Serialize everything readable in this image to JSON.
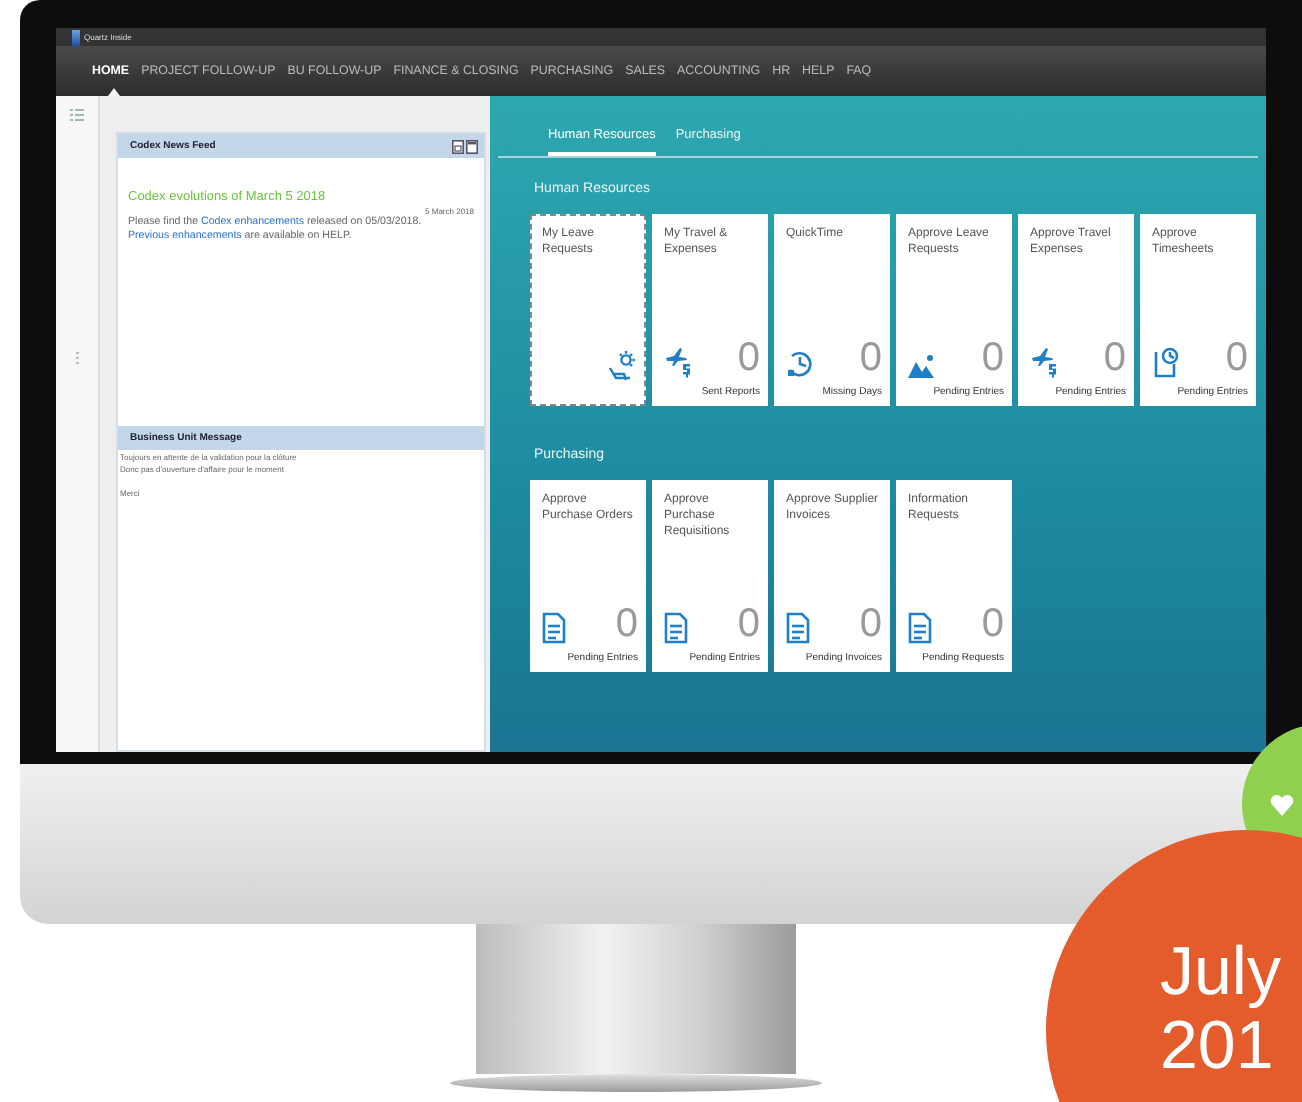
{
  "app": {
    "title": "Quartz Inside"
  },
  "nav": [
    {
      "label": "HOME",
      "selected": true
    },
    {
      "label": "PROJECT FOLLOW-UP",
      "selected": false
    },
    {
      "label": "BU FOLLOW-UP",
      "selected": false
    },
    {
      "label": "FINANCE & CLOSING",
      "selected": false
    },
    {
      "label": "PURCHASING",
      "selected": false
    },
    {
      "label": "SALES",
      "selected": false
    },
    {
      "label": "ACCOUNTING",
      "selected": false
    },
    {
      "label": "HR",
      "selected": false
    },
    {
      "label": "HELP",
      "selected": false
    },
    {
      "label": "FAQ",
      "selected": false
    }
  ],
  "news_feed": {
    "title": "Codex News Feed",
    "headline": "Codex evolutions of March 5 2018",
    "date": "5 March 2018",
    "body": [
      {
        "kind": "text",
        "text": "Please find the "
      },
      {
        "kind": "link",
        "text": "Codex enhancements"
      },
      {
        "kind": "text",
        "text": " released on 05/03/2018. "
      },
      {
        "kind": "link",
        "text": "Previous enhancements"
      },
      {
        "kind": "text",
        "text": " are available on HELP."
      }
    ]
  },
  "unit_message": {
    "title": "Business Unit Message",
    "lines": [
      "Toujours en attente de la validation pour la clôture",
      "Donc pas d'ouverture d'affaire pour le moment",
      "Merci"
    ]
  },
  "launchpad": {
    "tabs": [
      {
        "label": "Human Resources",
        "selected": true
      },
      {
        "label": "Purchasing",
        "selected": false
      }
    ],
    "groups": [
      {
        "title": "Human Resources",
        "tiles": [
          {
            "title": "My Leave Requests",
            "kind": "sun",
            "focused": true
          },
          {
            "title": "My Travel & Expenses",
            "kind": "plane",
            "count": "0",
            "footer": "Sent Reports",
            "focused": false
          },
          {
            "title": "QuickTime",
            "kind": "clock",
            "count": "0",
            "footer": "Missing Days",
            "focused": false
          },
          {
            "title": "Approve Leave Requests",
            "kind": "mountains",
            "count": "0",
            "footer": "Pending Entries",
            "focused": false
          },
          {
            "title": "Approve Travel Expenses",
            "kind": "plane",
            "count": "0",
            "footer": "Pending Entries",
            "focused": false
          },
          {
            "title": "Approve Timesheets",
            "kind": "timesheet",
            "count": "0",
            "footer": "Pending Entries",
            "focused": false
          }
        ]
      },
      {
        "title": "Purchasing",
        "tiles": [
          {
            "title": "Approve Purchase Orders",
            "kind": "document",
            "count": "0",
            "footer": "Pending Entries",
            "focused": false
          },
          {
            "title": "Approve Purchase Requisitions",
            "kind": "document",
            "count": "0",
            "footer": "Pending Entries",
            "focused": false
          },
          {
            "title": "Approve Supplier Invoices",
            "kind": "document",
            "count": "0",
            "footer": "Pending Invoices",
            "focused": false
          },
          {
            "title": "Information Requests",
            "kind": "document",
            "count": "0",
            "footer": "Pending Requests",
            "focused": false
          }
        ]
      }
    ]
  },
  "badge": {
    "lines": [
      "July",
      "201"
    ]
  }
}
